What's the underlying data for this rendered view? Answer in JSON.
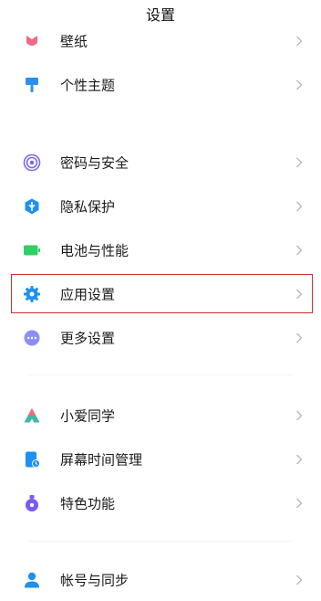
{
  "header": {
    "title": "设置"
  },
  "items": [
    {
      "label": "壁纸",
      "icon": "wallpaper-icon",
      "color": "#f06a82"
    },
    {
      "label": "个性主题",
      "icon": "paint-brush-icon",
      "color": "#2c8ff0"
    },
    {
      "label": "密码与安全",
      "icon": "fingerprint-icon",
      "color": "#7c6bf0"
    },
    {
      "label": "隐私保护",
      "icon": "privacy-shield-icon",
      "color": "#1e90f0"
    },
    {
      "label": "电池与性能",
      "icon": "battery-icon",
      "color": "#2fcf63"
    },
    {
      "label": "应用设置",
      "icon": "gear-icon",
      "color": "#1e90f0",
      "highlighted": true
    },
    {
      "label": "更多设置",
      "icon": "more-icon",
      "color": "#8b8ff5"
    },
    {
      "label": "小爱同学",
      "icon": "xiaoai-icon",
      "color": "#4c8df5"
    },
    {
      "label": "屏幕时间管理",
      "icon": "screen-time-icon",
      "color": "#1e90f0"
    },
    {
      "label": "特色功能",
      "icon": "special-features-icon",
      "color": "#7a5af5"
    },
    {
      "label": "帐号与同步",
      "icon": "account-icon",
      "color": "#1e90f0"
    }
  ],
  "colors": {
    "highlight_border": "#c9302c",
    "chevron": "#b8b8b8"
  }
}
